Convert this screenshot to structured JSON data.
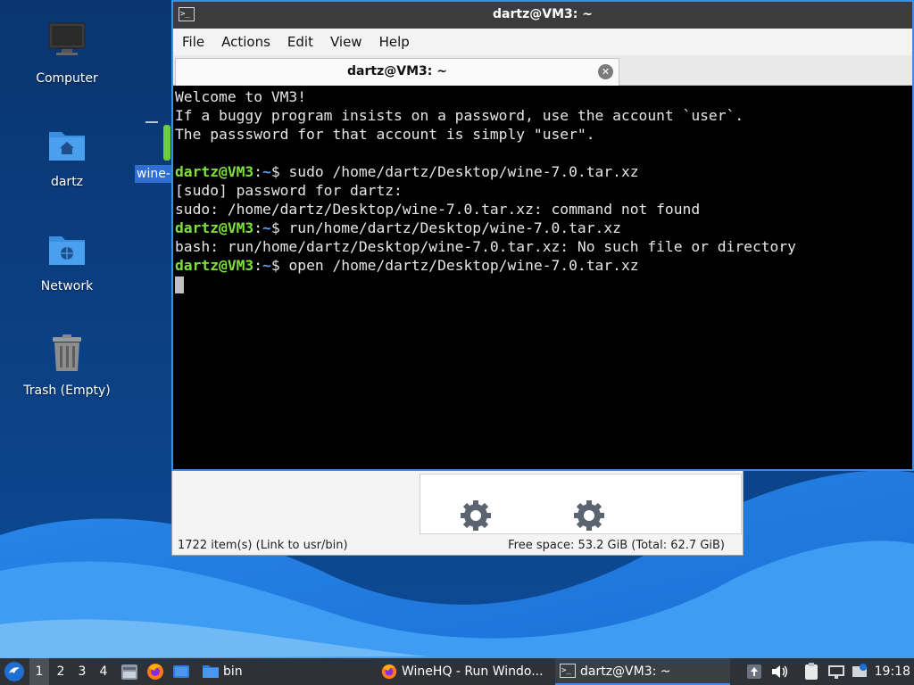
{
  "desktop": {
    "icons": [
      {
        "label": "Computer"
      },
      {
        "label": "dartz"
      },
      {
        "label": "Network"
      },
      {
        "label": "Trash (Empty)"
      }
    ],
    "selected_label": "wine-"
  },
  "terminal": {
    "window_title": "dartz@VM3: ~",
    "menu": [
      "File",
      "Actions",
      "Edit",
      "View",
      "Help"
    ],
    "tab_title": "dartz@VM3: ~",
    "lines": [
      {
        "text": "Welcome to VM3!"
      },
      {
        "text": "If a buggy program insists on a password, use the account `user`."
      },
      {
        "text": "The passsword for that account is simply \"user\"."
      },
      {
        "text": ""
      },
      {
        "user": "dartz@VM3",
        "path": "~",
        "cmd": "$ sudo /home/dartz/Desktop/wine-7.0.tar.xz"
      },
      {
        "text": "[sudo] password for dartz:"
      },
      {
        "text": "sudo: /home/dartz/Desktop/wine-7.0.tar.xz: command not found"
      },
      {
        "user": "dartz@VM3",
        "path": "~",
        "cmd": "$ run/home/dartz/Desktop/wine-7.0.tar.xz"
      },
      {
        "text": "bash: run/home/dartz/Desktop/wine-7.0.tar.xz: No such file or directory"
      },
      {
        "user": "dartz@VM3",
        "path": "~",
        "cmd": "$ open /home/dartz/Desktop/wine-7.0.tar.xz"
      }
    ]
  },
  "file_manager": {
    "status_left": "1722 item(s) (Link to usr/bin)",
    "status_right": "Free space: 53.2 GiB (Total: 62.7 GiB)"
  },
  "taskbar": {
    "workspaces": [
      "1",
      "2",
      "3",
      "4"
    ],
    "active_workspace": "1",
    "quicklaunch": [
      {
        "icon": "file-manager-icon"
      },
      {
        "icon": "firefox-icon"
      },
      {
        "icon": "show-desktop-icon"
      }
    ],
    "bin_label": "bin",
    "tasks": [
      {
        "label": "WineHQ - Run Windo...",
        "icon": "firefox-icon"
      },
      {
        "label": "dartz@VM3: ~",
        "icon": "terminal-icon"
      }
    ],
    "clock": "19:18"
  },
  "colors": {
    "accent": "#3d8ee6",
    "prompt_user": "#7ee03a",
    "prompt_path": "#5aa0f0"
  }
}
